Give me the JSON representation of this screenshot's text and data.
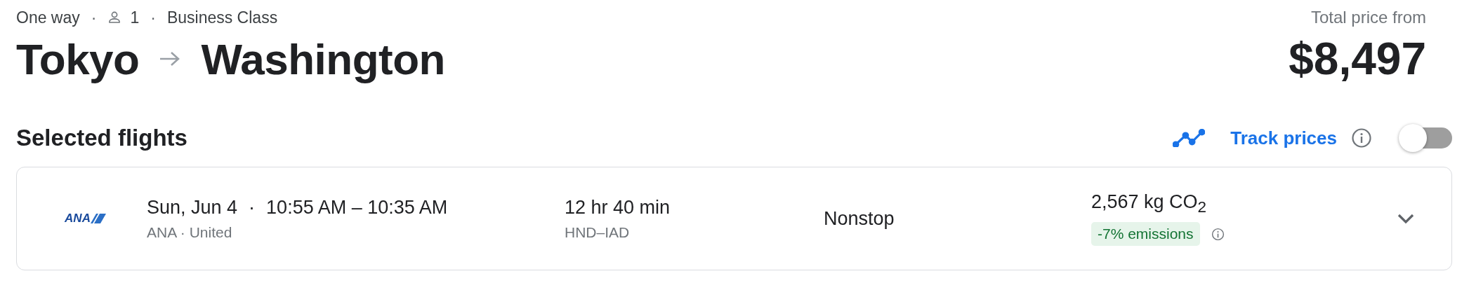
{
  "trip": {
    "type": "One way",
    "separator_1": "·",
    "passengers": "1",
    "separator_2": "·",
    "cabin": "Business Class"
  },
  "route": {
    "origin": "Tokyo",
    "destination": "Washington"
  },
  "price": {
    "label": "Total price from",
    "amount": "$8,497"
  },
  "section_title": "Selected flights",
  "track_prices": {
    "label": "Track prices",
    "on": false
  },
  "flights": [
    {
      "airline_logo": "ANA",
      "date": "Sun, Jun 4",
      "separator": "·",
      "times": "10:55 AM – 10:35 AM",
      "airlines": "ANA · United",
      "duration": "12 hr 40 min",
      "airports": "HND–IAD",
      "stops": "Nonstop",
      "emissions": "2,567 kg CO$_{2}$",
      "emissions_badge": "-7% emissions",
      "expanded": false
    }
  ]
}
